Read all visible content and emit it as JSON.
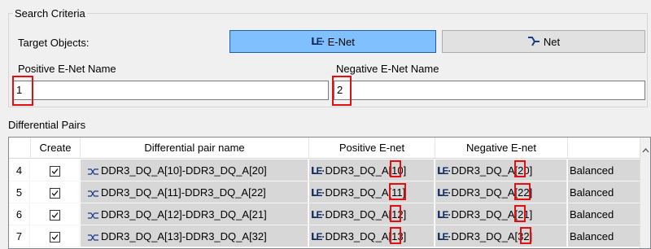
{
  "search": {
    "title": "Search Criteria",
    "target_label": "Target Objects:",
    "enet_button": "E-Net",
    "net_button": "Net",
    "positive_label": "Positive E-Net Name",
    "negative_label": "Negative E-Net Name",
    "positive_value": "1",
    "negative_value": "2"
  },
  "diff": {
    "title": "Differential Pairs",
    "columns": [
      "Create",
      "Differential pair name",
      "Positive E-net",
      "Negative E-net",
      ""
    ],
    "rows": [
      {
        "num": "4",
        "created": true,
        "name": "DDR3_DQ_A[10]-DDR3_DQ_A[20]",
        "positive": "DDR3_DQ_A[10]",
        "negative": "DDR3_DQ_A[20]",
        "status": "Balanced"
      },
      {
        "num": "5",
        "created": true,
        "name": "DDR3_DQ_A[11]-DDR3_DQ_A[22]",
        "positive": "DDR3_DQ_A[11]",
        "negative": "DDR3_DQ_A[22]",
        "status": "Balanced"
      },
      {
        "num": "6",
        "created": true,
        "name": "DDR3_DQ_A[12]-DDR3_DQ_A[21]",
        "positive": "DDR3_DQ_A[12]",
        "negative": "DDR3_DQ_A[21]",
        "status": "Balanced"
      },
      {
        "num": "7",
        "created": true,
        "name": "DDR3_DQ_A[13]-DDR3_DQ_A[32]",
        "positive": "DDR3_DQ_A[13]",
        "negative": "DDR3_DQ_A[32]",
        "status": "Balanced"
      }
    ]
  },
  "colors": {
    "selected_button": "#80c0ff",
    "highlight": "#e01010",
    "row_bg": "#d7d7d7"
  }
}
